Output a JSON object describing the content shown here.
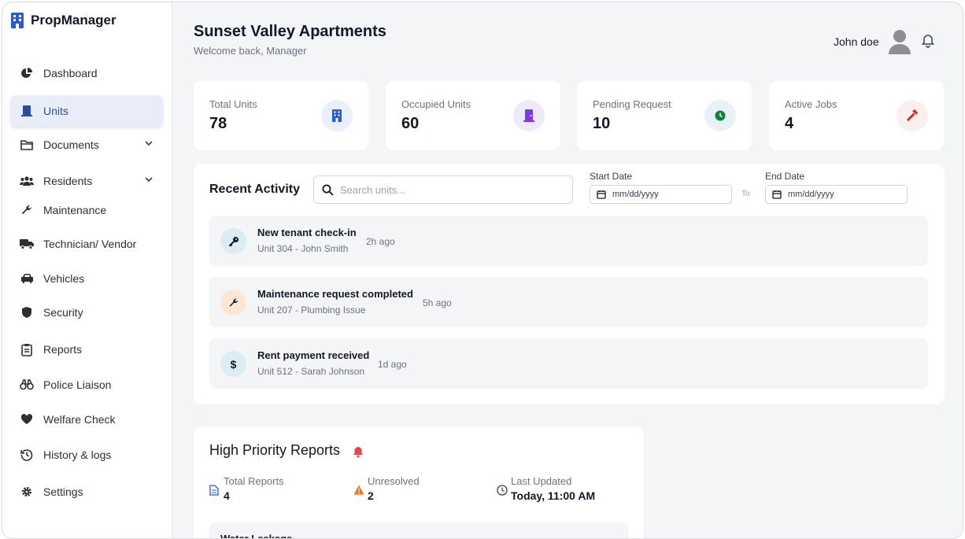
{
  "app": {
    "brand": "PropManager"
  },
  "sidebar": {
    "items": [
      {
        "label": "Dashboard",
        "icon": "pie-chart-icon"
      },
      {
        "label": "Units",
        "icon": "door-icon",
        "active": true
      },
      {
        "label": "Documents",
        "icon": "folder-icon",
        "expandable": true
      },
      {
        "label": "Residents",
        "icon": "users-icon",
        "expandable": true
      },
      {
        "label": "Maintenance",
        "icon": "wrench-icon"
      },
      {
        "label": "Technician/ Vendor",
        "icon": "truck-icon"
      },
      {
        "label": "Vehicles",
        "icon": "car-icon"
      },
      {
        "label": "Security",
        "icon": "shield-icon"
      },
      {
        "label": "Reports",
        "icon": "clipboard-icon"
      },
      {
        "label": "Police Liaison",
        "icon": "binoculars-icon"
      },
      {
        "label": "Welfare Check",
        "icon": "heart-icon"
      },
      {
        "label": "History & logs",
        "icon": "history-icon"
      },
      {
        "label": "Settings",
        "icon": "gear-icon"
      }
    ]
  },
  "header": {
    "title": "Sunset Valley Apartments",
    "subtitle": "Welcome back, Manager",
    "user_name": "John doe"
  },
  "stats": [
    {
      "label": "Total Units",
      "value": "78",
      "icon": "building-icon",
      "color": "#2a5bd7",
      "bg": "#eaf0fb"
    },
    {
      "label": "Occupied Units",
      "value": "60",
      "icon": "door-icon",
      "color": "#7c3aed",
      "bg": "#efeafb"
    },
    {
      "label": "Pending Request",
      "value": "10",
      "icon": "clock-icon",
      "color": "#15803d",
      "bg": "#e8f1f6"
    },
    {
      "label": "Active Jobs",
      "value": "4",
      "icon": "hammer-icon",
      "color": "#dc2626",
      "bg": "#f9efee"
    }
  ],
  "activity": {
    "title": "Recent Activity",
    "search_placeholder": "Search units...",
    "start_date_label": "Start Date",
    "end_date_label": "End Date",
    "date_placeholder": "mm/dd/yyyy",
    "to_label": "To",
    "items": [
      {
        "title": "New tenant check-in",
        "subtitle": "Unit 304 - John Smith",
        "time": "2h ago",
        "icon": "key-icon",
        "bg": "#dcecf3"
      },
      {
        "title": "Maintenance request completed",
        "subtitle": "Unit 207 - Plumbing Issue",
        "time": "5h ago",
        "icon": "wrench-icon",
        "bg": "#fde6d3"
      },
      {
        "title": "Rent payment received",
        "subtitle": "Unit 512 - Sarah Johnson",
        "time": "1d ago",
        "icon": "dollar-icon",
        "bg": "#dcecf3"
      }
    ]
  },
  "high_priority": {
    "title": "High Priority Reports",
    "stats": [
      {
        "label": "Total Reports",
        "value": "4",
        "icon": "document-icon"
      },
      {
        "label": "Unresolved",
        "value": "2",
        "icon": "warning-icon"
      },
      {
        "label": "Last Updated",
        "value": "Today, 11:00 AM",
        "icon": "clock-icon"
      }
    ],
    "first_item": "Water Leakage"
  },
  "colors": {
    "accent": "#2a4ea8",
    "alert": "#ef4444",
    "warning": "#f97316"
  }
}
